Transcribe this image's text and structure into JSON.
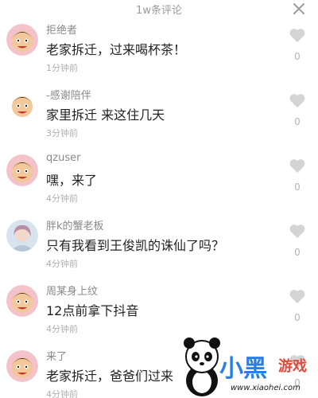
{
  "header": {
    "title": "1w条评论",
    "close_icon": "close-icon"
  },
  "comments": [
    {
      "avatar": "cartoon-avatar",
      "username": "拒绝者",
      "text": "老家拆迁，过来喝杯茶！",
      "time": "1分钟前",
      "likes": "0"
    },
    {
      "avatar": "cartoon-avatar",
      "username": "-感谢陪伴",
      "text": "家里拆迁 来这住几天",
      "time": "3分钟前",
      "likes": "0"
    },
    {
      "avatar": "cartoon-avatar",
      "username": "qzuser",
      "text": "嘿，来了",
      "time": "4分钟前",
      "likes": "0"
    },
    {
      "avatar": "photo-avatar",
      "username": "胖k的蟹老板",
      "text": "只有我看到王俊凯的诛仙了吗？",
      "time": "4分钟前",
      "likes": "0"
    },
    {
      "avatar": "cartoon-avatar",
      "username": "周某身上纹",
      "text": "12点前拿下抖音",
      "time": "4分钟前",
      "likes": "0"
    },
    {
      "avatar": "cartoon-avatar",
      "username": "来了",
      "text": "老家拆迁，爸爸们过来",
      "time": "4分钟前",
      "likes": "0"
    }
  ],
  "watermark": {
    "logo": "小黑",
    "logo_sub": "游戏",
    "url": "www.xiaohei.com"
  },
  "colors": {
    "heart": "#d4d4d4",
    "username": "#8a8a8a",
    "time": "#b0b0b0",
    "text": "#222222"
  }
}
